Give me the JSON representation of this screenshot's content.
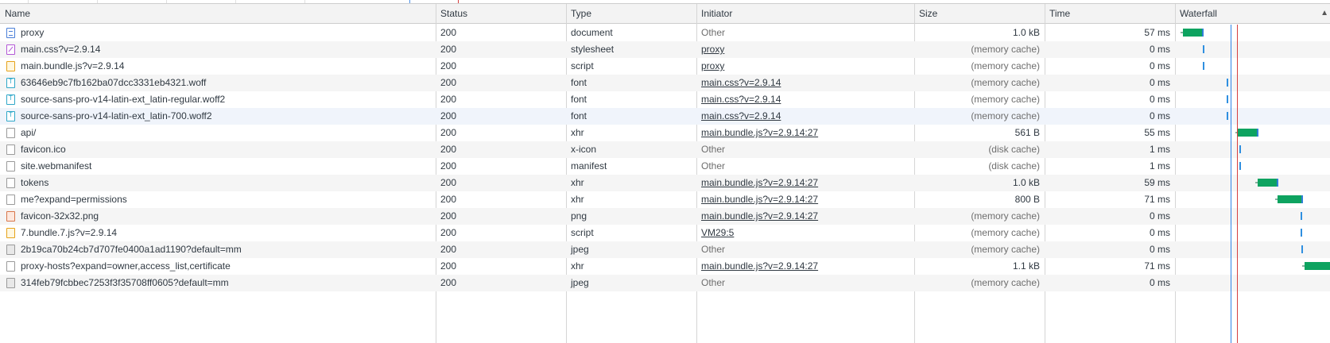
{
  "columns": {
    "name": "Name",
    "status": "Status",
    "type": "Type",
    "initiator": "Initiator",
    "size": "Size",
    "time": "Time",
    "waterfall": "Waterfall"
  },
  "sort_icon": "sort-ascending-icon",
  "colors": {
    "waterfall_bar": "#0ea360",
    "waterfall_receive": "#2f7fd8",
    "dom_content_loaded_line": "#2e83e6",
    "load_line": "#d64040"
  },
  "requests": [
    {
      "name": "proxy",
      "icon": "document-icon",
      "status": "200",
      "type": "document",
      "initiator": "Other",
      "initiator_link": false,
      "size": "1.0 kB",
      "time": "57 ms"
    },
    {
      "name": "main.css?v=2.9.14",
      "icon": "stylesheet-icon",
      "status": "200",
      "type": "stylesheet",
      "initiator": "proxy",
      "initiator_link": true,
      "size": "(memory cache)",
      "time": "0 ms"
    },
    {
      "name": "main.bundle.js?v=2.9.14",
      "icon": "script-icon",
      "status": "200",
      "type": "script",
      "initiator": "proxy",
      "initiator_link": true,
      "size": "(memory cache)",
      "time": "0 ms"
    },
    {
      "name": "63646eb9c7fb162ba07dcc3331eb4321.woff",
      "icon": "font-icon",
      "status": "200",
      "type": "font",
      "initiator": "main.css?v=2.9.14",
      "initiator_link": true,
      "size": "(memory cache)",
      "time": "0 ms"
    },
    {
      "name": "source-sans-pro-v14-latin-ext_latin-regular.woff2",
      "icon": "font-icon",
      "status": "200",
      "type": "font",
      "initiator": "main.css?v=2.9.14",
      "initiator_link": true,
      "size": "(memory cache)",
      "time": "0 ms"
    },
    {
      "name": "source-sans-pro-v14-latin-ext_latin-700.woff2",
      "icon": "font-icon",
      "status": "200",
      "type": "font",
      "initiator": "main.css?v=2.9.14",
      "initiator_link": true,
      "size": "(memory cache)",
      "time": "0 ms"
    },
    {
      "name": "api/",
      "icon": "xhr-icon",
      "status": "200",
      "type": "xhr",
      "initiator": "main.bundle.js?v=2.9.14:27",
      "initiator_link": true,
      "size": "561 B",
      "time": "55 ms"
    },
    {
      "name": "favicon.ico",
      "icon": "file-icon",
      "status": "200",
      "type": "x-icon",
      "initiator": "Other",
      "initiator_link": false,
      "size": "(disk cache)",
      "time": "1 ms"
    },
    {
      "name": "site.webmanifest",
      "icon": "file-icon",
      "status": "200",
      "type": "manifest",
      "initiator": "Other",
      "initiator_link": false,
      "size": "(disk cache)",
      "time": "1 ms"
    },
    {
      "name": "tokens",
      "icon": "xhr-icon",
      "status": "200",
      "type": "xhr",
      "initiator": "main.bundle.js?v=2.9.14:27",
      "initiator_link": true,
      "size": "1.0 kB",
      "time": "59 ms"
    },
    {
      "name": "me?expand=permissions",
      "icon": "xhr-icon",
      "status": "200",
      "type": "xhr",
      "initiator": "main.bundle.js?v=2.9.14:27",
      "initiator_link": true,
      "size": "800 B",
      "time": "71 ms"
    },
    {
      "name": "favicon-32x32.png",
      "icon": "png-icon",
      "status": "200",
      "type": "png",
      "initiator": "main.bundle.js?v=2.9.14:27",
      "initiator_link": true,
      "size": "(memory cache)",
      "time": "0 ms"
    },
    {
      "name": "7.bundle.7.js?v=2.9.14",
      "icon": "script-icon",
      "status": "200",
      "type": "script",
      "initiator": "VM29:5",
      "initiator_link": true,
      "size": "(memory cache)",
      "time": "0 ms"
    },
    {
      "name": "2b19ca70b24cb7d707fe0400a1ad1190?default=mm",
      "icon": "image-icon",
      "status": "200",
      "type": "jpeg",
      "initiator": "Other",
      "initiator_link": false,
      "size": "(memory cache)",
      "time": "0 ms"
    },
    {
      "name": "proxy-hosts?expand=owner,access_list,certificate",
      "icon": "xhr-icon",
      "status": "200",
      "type": "xhr",
      "initiator": "main.bundle.js?v=2.9.14:27",
      "initiator_link": true,
      "size": "1.1 kB",
      "time": "71 ms"
    },
    {
      "name": "314feb79fcbbec7253f3f35708ff0605?default=mm",
      "icon": "image-icon",
      "status": "200",
      "type": "jpeg",
      "initiator": "Other",
      "initiator_link": false,
      "size": "(memory cache)",
      "time": "0 ms"
    }
  ]
}
